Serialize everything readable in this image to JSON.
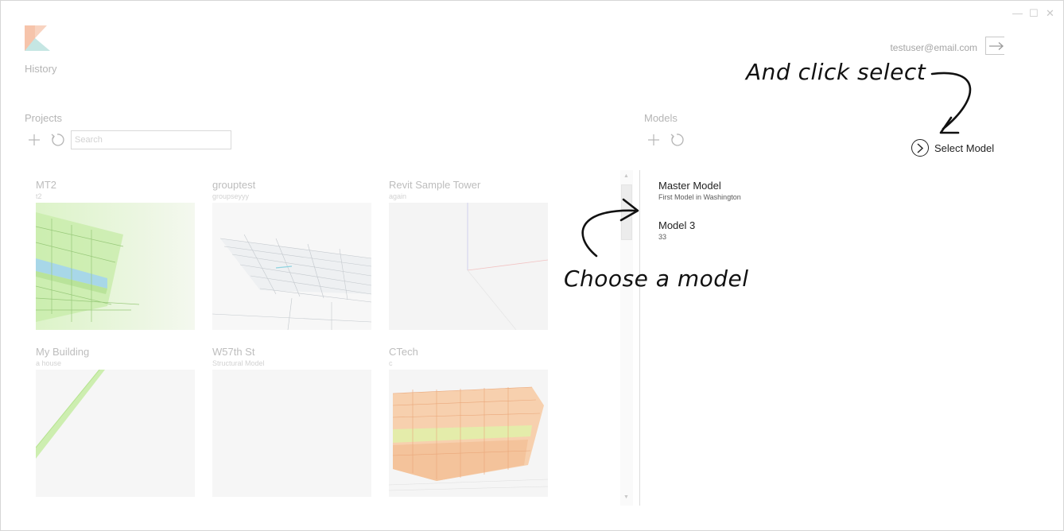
{
  "window": {
    "minimize_glyph": "—",
    "maximize_glyph": "☐",
    "close_glyph": "✕"
  },
  "header": {
    "nav_history": "History",
    "user_email": "testuser@email.com",
    "logo_colors": [
      "#f6c4ab",
      "#c5e6e3"
    ]
  },
  "projects": {
    "title": "Projects",
    "search_placeholder": "Search",
    "items": [
      {
        "name": "MT2",
        "description": "t2"
      },
      {
        "name": "grouptest",
        "description": "groupseyyy"
      },
      {
        "name": "Revit Sample Tower",
        "description": "again"
      },
      {
        "name": "My Building",
        "description": "a house"
      },
      {
        "name": "W57th St",
        "description": "Structural Model"
      },
      {
        "name": "CTech",
        "description": "c"
      }
    ]
  },
  "models": {
    "title": "Models",
    "items": [
      {
        "name": "Master Model",
        "description": "First Model in Washington"
      },
      {
        "name": "Model 3",
        "description": "33"
      }
    ],
    "select_label": "Select Model"
  },
  "annotations": {
    "click_select": "And click select",
    "choose_model": "Choose a model"
  }
}
